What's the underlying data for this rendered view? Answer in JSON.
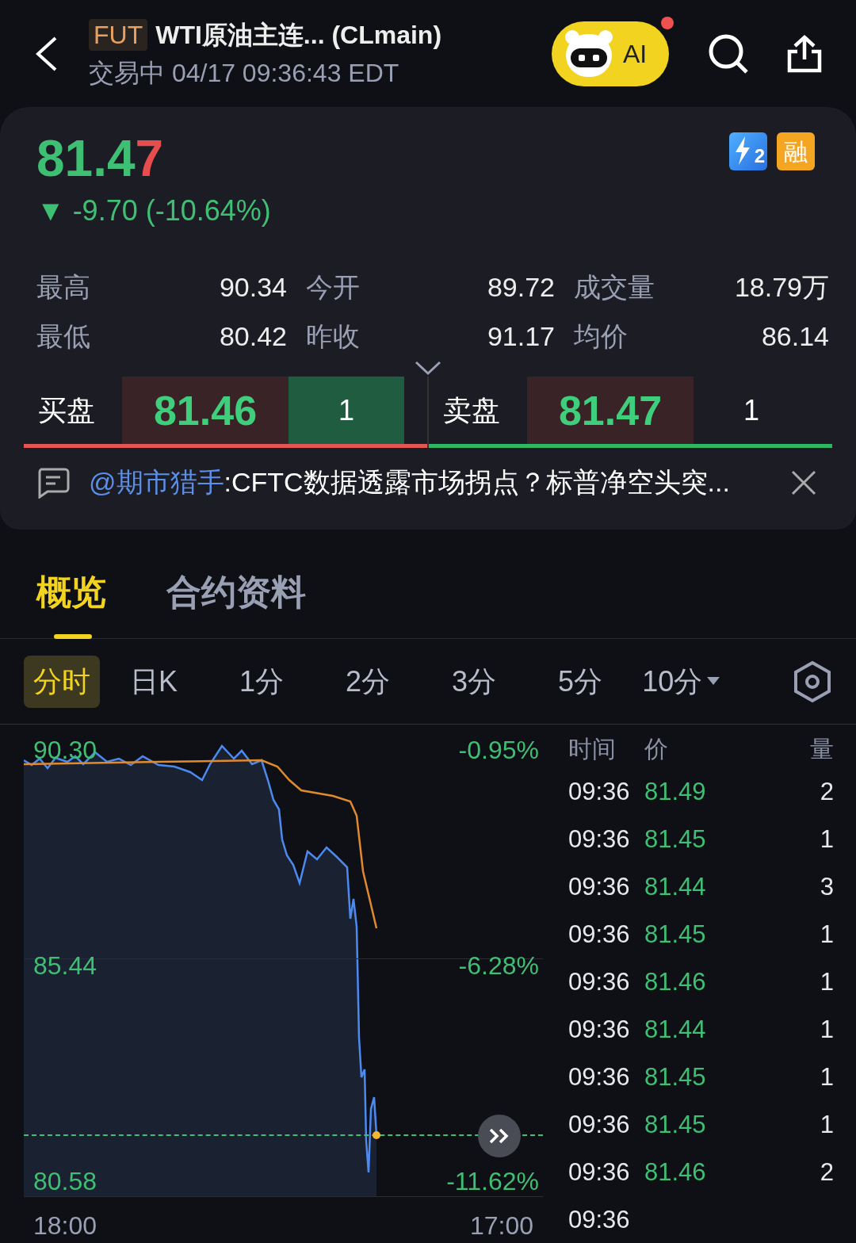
{
  "header": {
    "badge": "FUT",
    "title": "WTI原油主连... (CLmain)",
    "status": "交易中 04/17 09:36:43 EDT",
    "ai_button": {
      "label": "AI",
      "notification": true
    }
  },
  "quote": {
    "price_parts": [
      {
        "text": "81.4",
        "color": "#3fbf74"
      },
      {
        "text": "7",
        "color": "#e84d4d"
      }
    ],
    "change": "▼ -9.70 (-10.64%)",
    "badges": [
      {
        "kind": "level",
        "text": "2"
      },
      {
        "kind": "margin",
        "text": "融"
      }
    ],
    "stats": [
      {
        "label": "最高",
        "value": "90.34"
      },
      {
        "label": "今开",
        "value": "89.72"
      },
      {
        "label": "成交量",
        "value": "18.79万"
      },
      {
        "label": "最低",
        "value": "80.42"
      },
      {
        "label": "昨收",
        "value": "91.17"
      },
      {
        "label": "均价",
        "value": "86.14"
      }
    ],
    "bid": {
      "label": "买盘",
      "price": "81.46",
      "qty": "1",
      "highlighted": true
    },
    "ask": {
      "label": "卖盘",
      "price": "81.47",
      "qty": "1",
      "highlighted": false
    },
    "news": {
      "mention": "@期市猎手",
      "text": ":CFTC数据透露市场拐点？标普净空头突..."
    }
  },
  "tabs": [
    {
      "label": "概览",
      "selected": true
    },
    {
      "label": "合约资料",
      "selected": false
    }
  ],
  "periods": [
    {
      "label": "分时",
      "selected": true
    },
    {
      "label": "日K",
      "selected": false
    },
    {
      "label": "1分",
      "selected": false
    },
    {
      "label": "2分",
      "selected": false
    },
    {
      "label": "3分",
      "selected": false
    },
    {
      "label": "5分",
      "selected": false
    },
    {
      "label": "10分",
      "selected": false,
      "dropdown": true
    }
  ],
  "chart": {
    "price_labels": [
      "90.30",
      "85.44",
      "80.58"
    ],
    "pct_labels": [
      "-0.95%",
      "-6.28%",
      "-11.62%"
    ],
    "time_start": "18:00",
    "time_end": "17:00"
  },
  "ticks": {
    "columns": [
      "时间",
      "价",
      "量"
    ],
    "rows": [
      {
        "time": "09:36",
        "price": "81.49",
        "qty": "2"
      },
      {
        "time": "09:36",
        "price": "81.45",
        "qty": "1"
      },
      {
        "time": "09:36",
        "price": "81.44",
        "qty": "3"
      },
      {
        "time": "09:36",
        "price": "81.45",
        "qty": "1"
      },
      {
        "time": "09:36",
        "price": "81.46",
        "qty": "1"
      },
      {
        "time": "09:36",
        "price": "81.44",
        "qty": "1"
      },
      {
        "time": "09:36",
        "price": "81.45",
        "qty": "1"
      },
      {
        "time": "09:36",
        "price": "81.45",
        "qty": "1"
      },
      {
        "time": "09:36",
        "price": "81.46",
        "qty": "2"
      },
      {
        "time": "09:36"
      }
    ]
  }
}
